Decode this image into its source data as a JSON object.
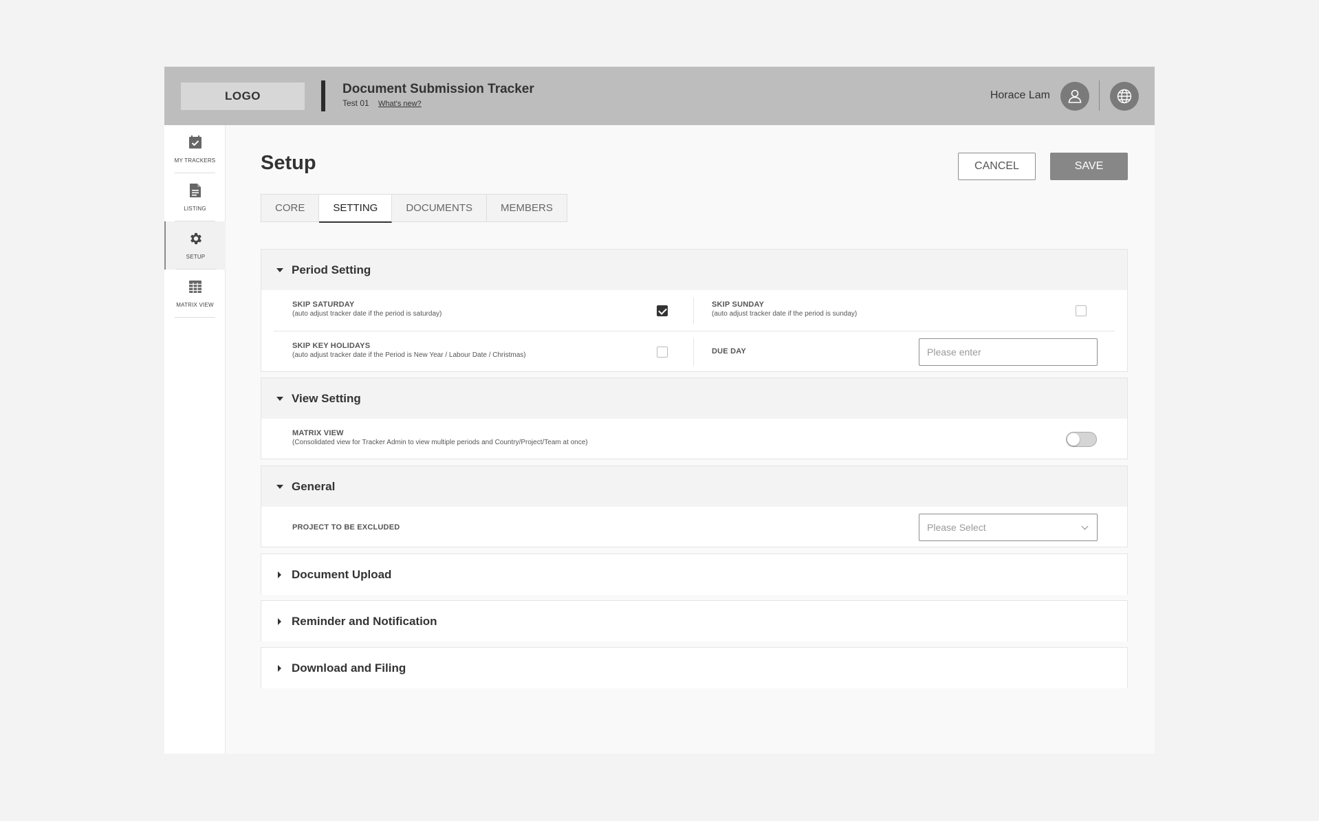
{
  "header": {
    "logo": "LOGO",
    "title": "Document Submission Tracker",
    "subtitle": "Test 01",
    "whats_new": "What's new?",
    "user_name": "Horace Lam"
  },
  "sidebar": {
    "items": [
      {
        "label": "MY TRACKERS",
        "icon": "calendar-check-icon"
      },
      {
        "label": "LISTING",
        "icon": "document-icon"
      },
      {
        "label": "SETUP",
        "icon": "gear-icon",
        "active": true
      },
      {
        "label": "MATRIX VIEW",
        "icon": "grid-icon"
      }
    ]
  },
  "main": {
    "title": "Setup",
    "cancel_label": "CANCEL",
    "save_label": "SAVE",
    "tabs": [
      {
        "label": "CORE"
      },
      {
        "label": "SETTING",
        "active": true
      },
      {
        "label": "DOCUMENTS"
      },
      {
        "label": "MEMBERS"
      }
    ]
  },
  "sections": {
    "period": {
      "title": "Period Setting",
      "skip_saturday": {
        "label": "SKIP SATURDAY",
        "desc": "(auto adjust tracker date if the period is saturday)",
        "checked": true
      },
      "skip_sunday": {
        "label": "SKIP SUNDAY",
        "desc": "(auto adjust tracker date if the period is sunday)",
        "checked": false
      },
      "skip_holidays": {
        "label": "SKIP KEY HOLIDAYS",
        "desc": "(auto adjust tracker date if the Period is New Year / Labour Date / Christmas)",
        "checked": false
      },
      "due_day": {
        "label": "DUE DAY",
        "placeholder": "Please enter",
        "value": ""
      }
    },
    "view": {
      "title": "View Setting",
      "matrix_view": {
        "label": "MATRIX VIEW",
        "desc": "(Consolidated view for Tracker Admin to view multiple periods and Country/Project/Team at once)",
        "enabled": false
      }
    },
    "general": {
      "title": "General",
      "project_excluded": {
        "label": "PROJECT TO BE EXCLUDED",
        "placeholder": "Please Select"
      }
    },
    "document_upload": {
      "title": "Document Upload"
    },
    "reminder": {
      "title": "Reminder and Notification"
    },
    "download": {
      "title": "Download and Filing"
    }
  }
}
